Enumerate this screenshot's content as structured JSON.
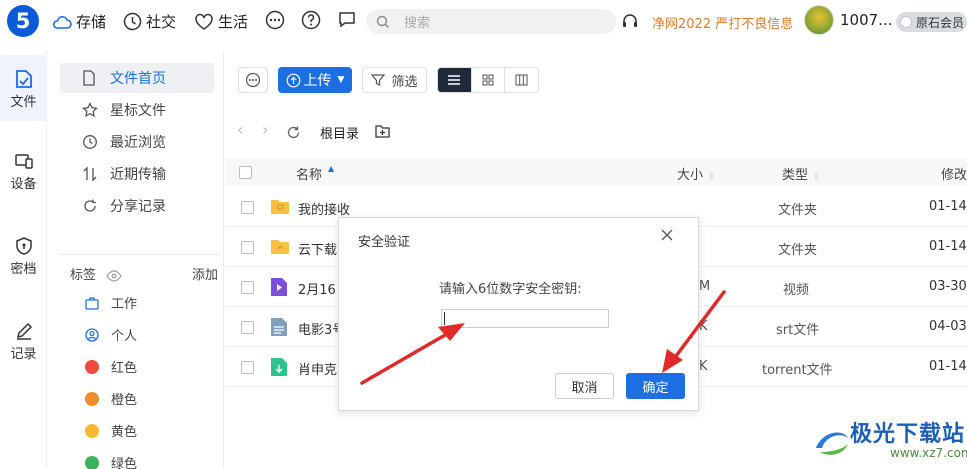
{
  "topbar": {
    "nav": [
      "存储",
      "社交",
      "生活"
    ],
    "search_placeholder": "搜索",
    "promo": "净网2022 严打不良信息",
    "user_id": "1007...",
    "member_label": "原石会员"
  },
  "leftrail": {
    "items": [
      "文件",
      "设备",
      "密档",
      "记录"
    ]
  },
  "sidebar": {
    "items": [
      "文件首页",
      "星标文件",
      "最近浏览",
      "近期传输",
      "分享记录"
    ],
    "tags_label": "标签",
    "add_label": "添加",
    "tags": [
      {
        "label": "工作",
        "color": "#1b6fe3"
      },
      {
        "label": "个人",
        "color": "#1b6fe3"
      },
      {
        "label": "红色",
        "color": "#ef4a3b"
      },
      {
        "label": "橙色",
        "color": "#f28c2a"
      },
      {
        "label": "黄色",
        "color": "#f5b82e"
      },
      {
        "label": "绿色",
        "color": "#3bb25b"
      }
    ]
  },
  "toolbar": {
    "upload_label": "上传",
    "filter_label": "筛选"
  },
  "breadcrumb": {
    "root": "根目录"
  },
  "table": {
    "headers": {
      "name": "名称",
      "size": "大小",
      "type": "类型",
      "modified": "修改"
    },
    "rows": [
      {
        "name": "我的接收",
        "size": "",
        "type": "文件夹",
        "modified": "01-14",
        "icon": "folder-icon"
      },
      {
        "name": "云下载",
        "size": "",
        "type": "文件夹",
        "modified": "01-14",
        "icon": "folder-icon"
      },
      {
        "name": "2月16",
        "size": "M",
        "type": "视频",
        "modified": "03-30",
        "icon": "video-file-icon"
      },
      {
        "name": "电影3号",
        "size": "K",
        "type": "srt文件",
        "modified": "04-03",
        "icon": "srt-file-icon"
      },
      {
        "name": "肖申克",
        "size": "K",
        "type": "torrent文件",
        "modified": "01-14",
        "icon": "torrent-file-icon"
      }
    ]
  },
  "dialog": {
    "title": "安全验证",
    "prompt": "请输入6位数字安全密钥:",
    "input_value": "",
    "cancel_label": "取消",
    "ok_label": "确定"
  },
  "watermark": {
    "title": "极光下载站",
    "url": "www.xz7.com"
  },
  "colors": {
    "accent": "#1b6fe3",
    "promo": "#e37b2f",
    "arrow": "#e02a2a"
  }
}
